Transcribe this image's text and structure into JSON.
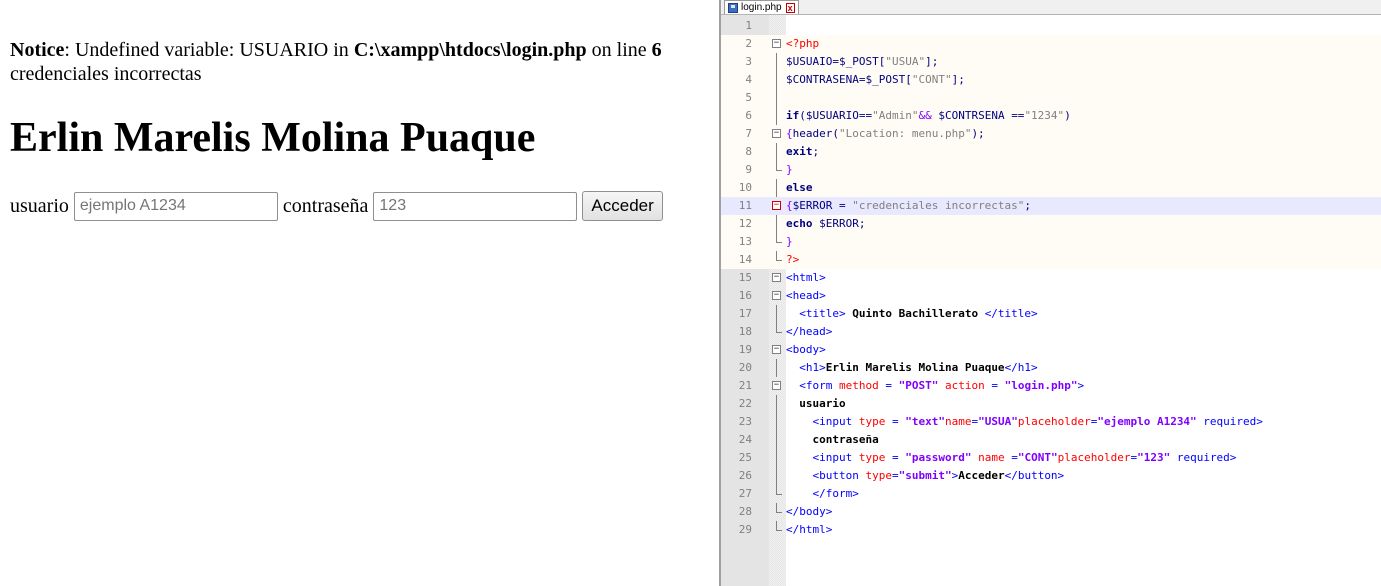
{
  "browser": {
    "notice_label": "Notice",
    "notice_text": ": Undefined variable: USUARIO in ",
    "notice_path": "C:\\xampp\\htdocs\\login.php",
    "notice_online": " on line ",
    "notice_line": "6",
    "message": "credenciales incorrectas",
    "heading": "Erlin Marelis Molina Puaque",
    "form": {
      "user_label": "usuario",
      "user_placeholder": "ejemplo A1234",
      "pass_label": "contraseña",
      "pass_placeholder": "123",
      "submit_label": "Acceder"
    }
  },
  "editor": {
    "tab_title": "login.php",
    "tab_close": "x",
    "code_lines": [
      {
        "n": "1",
        "fold": "",
        "seg": []
      },
      {
        "n": "2",
        "fold": "open",
        "seg": [
          [
            "phptag",
            "<?php"
          ]
        ]
      },
      {
        "n": "3",
        "fold": "line",
        "seg": [
          [
            "var",
            "$USUAIO=$_POST["
          ],
          [
            "str",
            "\"USUA\""
          ],
          [
            "var",
            "];"
          ]
        ]
      },
      {
        "n": "4",
        "fold": "line",
        "seg": [
          [
            "var",
            "$CONTRASENA=$_POST["
          ],
          [
            "str",
            "\"CONT\""
          ],
          [
            "var",
            "];"
          ]
        ]
      },
      {
        "n": "5",
        "fold": "line",
        "seg": []
      },
      {
        "n": "6",
        "fold": "line",
        "seg": [
          [
            "kw",
            "if"
          ],
          [
            "var",
            "($USUARIO=="
          ],
          [
            "str",
            "\"Admin\""
          ],
          [
            "op",
            "&&"
          ],
          [
            "var",
            " $CONTRSENA =="
          ],
          [
            "str",
            "\"1234\""
          ],
          [
            "var",
            ")"
          ]
        ]
      },
      {
        "n": "7",
        "fold": "open",
        "seg": [
          [
            "brace",
            "{"
          ],
          [
            "var",
            "header("
          ],
          [
            "str",
            "\"Location: menu.php\""
          ],
          [
            "var",
            ");"
          ]
        ]
      },
      {
        "n": "8",
        "fold": "line",
        "seg": [
          [
            "kw",
            "exit"
          ],
          [
            "var",
            ";"
          ]
        ]
      },
      {
        "n": "9",
        "fold": "end",
        "seg": [
          [
            "brace",
            "}"
          ]
        ]
      },
      {
        "n": "10",
        "fold": "line",
        "seg": [
          [
            "kw",
            "else"
          ]
        ]
      },
      {
        "n": "11",
        "fold": "openred",
        "seg": [
          [
            "brace",
            "{"
          ],
          [
            "var",
            "$ERROR = "
          ],
          [
            "str",
            "\"credenciales incorrectas\""
          ],
          [
            "var",
            ";"
          ]
        ]
      },
      {
        "n": "12",
        "fold": "line",
        "seg": [
          [
            "kw",
            "echo"
          ],
          [
            "var",
            " $ERROR;"
          ]
        ]
      },
      {
        "n": "13",
        "fold": "end",
        "seg": [
          [
            "brace",
            "}"
          ]
        ]
      },
      {
        "n": "14",
        "fold": "end",
        "seg": [
          [
            "phptag",
            "?>"
          ]
        ]
      },
      {
        "n": "15",
        "fold": "open",
        "seg": [
          [
            "tag",
            "<html>"
          ]
        ]
      },
      {
        "n": "16",
        "fold": "open",
        "seg": [
          [
            "tag",
            "<head>"
          ]
        ]
      },
      {
        "n": "17",
        "fold": "line",
        "seg": [
          [
            "plain",
            "  "
          ],
          [
            "tag",
            "<title>"
          ],
          [
            "bold",
            " Quinto Bachillerato "
          ],
          [
            "tag",
            "</title>"
          ]
        ]
      },
      {
        "n": "18",
        "fold": "end",
        "seg": [
          [
            "tag",
            "</head>"
          ]
        ]
      },
      {
        "n": "19",
        "fold": "open",
        "seg": [
          [
            "tag",
            "<body>"
          ]
        ]
      },
      {
        "n": "20",
        "fold": "line",
        "seg": [
          [
            "plain",
            "  "
          ],
          [
            "tag",
            "<h1>"
          ],
          [
            "bold",
            "Erlin Marelis Molina Puaque"
          ],
          [
            "tag",
            "</h1>"
          ]
        ]
      },
      {
        "n": "21",
        "fold": "open",
        "seg": [
          [
            "plain",
            "  "
          ],
          [
            "tag",
            "<form "
          ],
          [
            "attr",
            "method"
          ],
          [
            "tag",
            " = "
          ],
          [
            "hstr",
            "\"POST\""
          ],
          [
            "tag",
            " "
          ],
          [
            "attr",
            "action"
          ],
          [
            "tag",
            " = "
          ],
          [
            "hstr",
            "\"login.php\""
          ],
          [
            "tag",
            ">"
          ]
        ]
      },
      {
        "n": "22",
        "fold": "line",
        "seg": [
          [
            "plain",
            "  "
          ],
          [
            "bold",
            "usuario"
          ]
        ]
      },
      {
        "n": "23",
        "fold": "line",
        "seg": [
          [
            "plain",
            "    "
          ],
          [
            "tag",
            "<input "
          ],
          [
            "attr",
            "type"
          ],
          [
            "tag",
            " = "
          ],
          [
            "hstr",
            "\"text\""
          ],
          [
            "attr",
            "name"
          ],
          [
            "tag",
            "="
          ],
          [
            "hstr",
            "\"USUA\""
          ],
          [
            "attr",
            "placeholder"
          ],
          [
            "tag",
            "="
          ],
          [
            "hstr",
            "\"ejemplo A1234\""
          ],
          [
            "tag",
            " required>"
          ]
        ]
      },
      {
        "n": "24",
        "fold": "line",
        "seg": [
          [
            "plain",
            "    "
          ],
          [
            "bold",
            "contraseña"
          ]
        ]
      },
      {
        "n": "25",
        "fold": "line",
        "seg": [
          [
            "plain",
            "    "
          ],
          [
            "tag",
            "<input "
          ],
          [
            "attr",
            "type"
          ],
          [
            "tag",
            " = "
          ],
          [
            "hstr",
            "\"password\""
          ],
          [
            "tag",
            " "
          ],
          [
            "attr",
            "name"
          ],
          [
            "tag",
            " ="
          ],
          [
            "hstr",
            "\"CONT\""
          ],
          [
            "attr",
            "placeholder"
          ],
          [
            "tag",
            "="
          ],
          [
            "hstr",
            "\"123\""
          ],
          [
            "tag",
            " required>"
          ]
        ]
      },
      {
        "n": "26",
        "fold": "line",
        "seg": [
          [
            "plain",
            "    "
          ],
          [
            "tag",
            "<button "
          ],
          [
            "attr",
            "type"
          ],
          [
            "tag",
            "="
          ],
          [
            "hstr",
            "\"submit\""
          ],
          [
            "tag",
            ">"
          ],
          [
            "bold",
            "Acceder"
          ],
          [
            "tag",
            "</button>"
          ]
        ]
      },
      {
        "n": "27",
        "fold": "end",
        "seg": [
          [
            "plain",
            "    "
          ],
          [
            "tag",
            "</form>"
          ]
        ]
      },
      {
        "n": "28",
        "fold": "end",
        "seg": [
          [
            "tag",
            "</body>"
          ]
        ]
      },
      {
        "n": "29",
        "fold": "end",
        "seg": [
          [
            "tag",
            "</html>"
          ]
        ]
      }
    ]
  },
  "colors": {
    "keyword": "#000080",
    "string": "#808080",
    "html_tag": "#0000ff",
    "html_attr": "#ff0000",
    "html_value": "#8000ff",
    "current_line": "#e8e8ff"
  }
}
